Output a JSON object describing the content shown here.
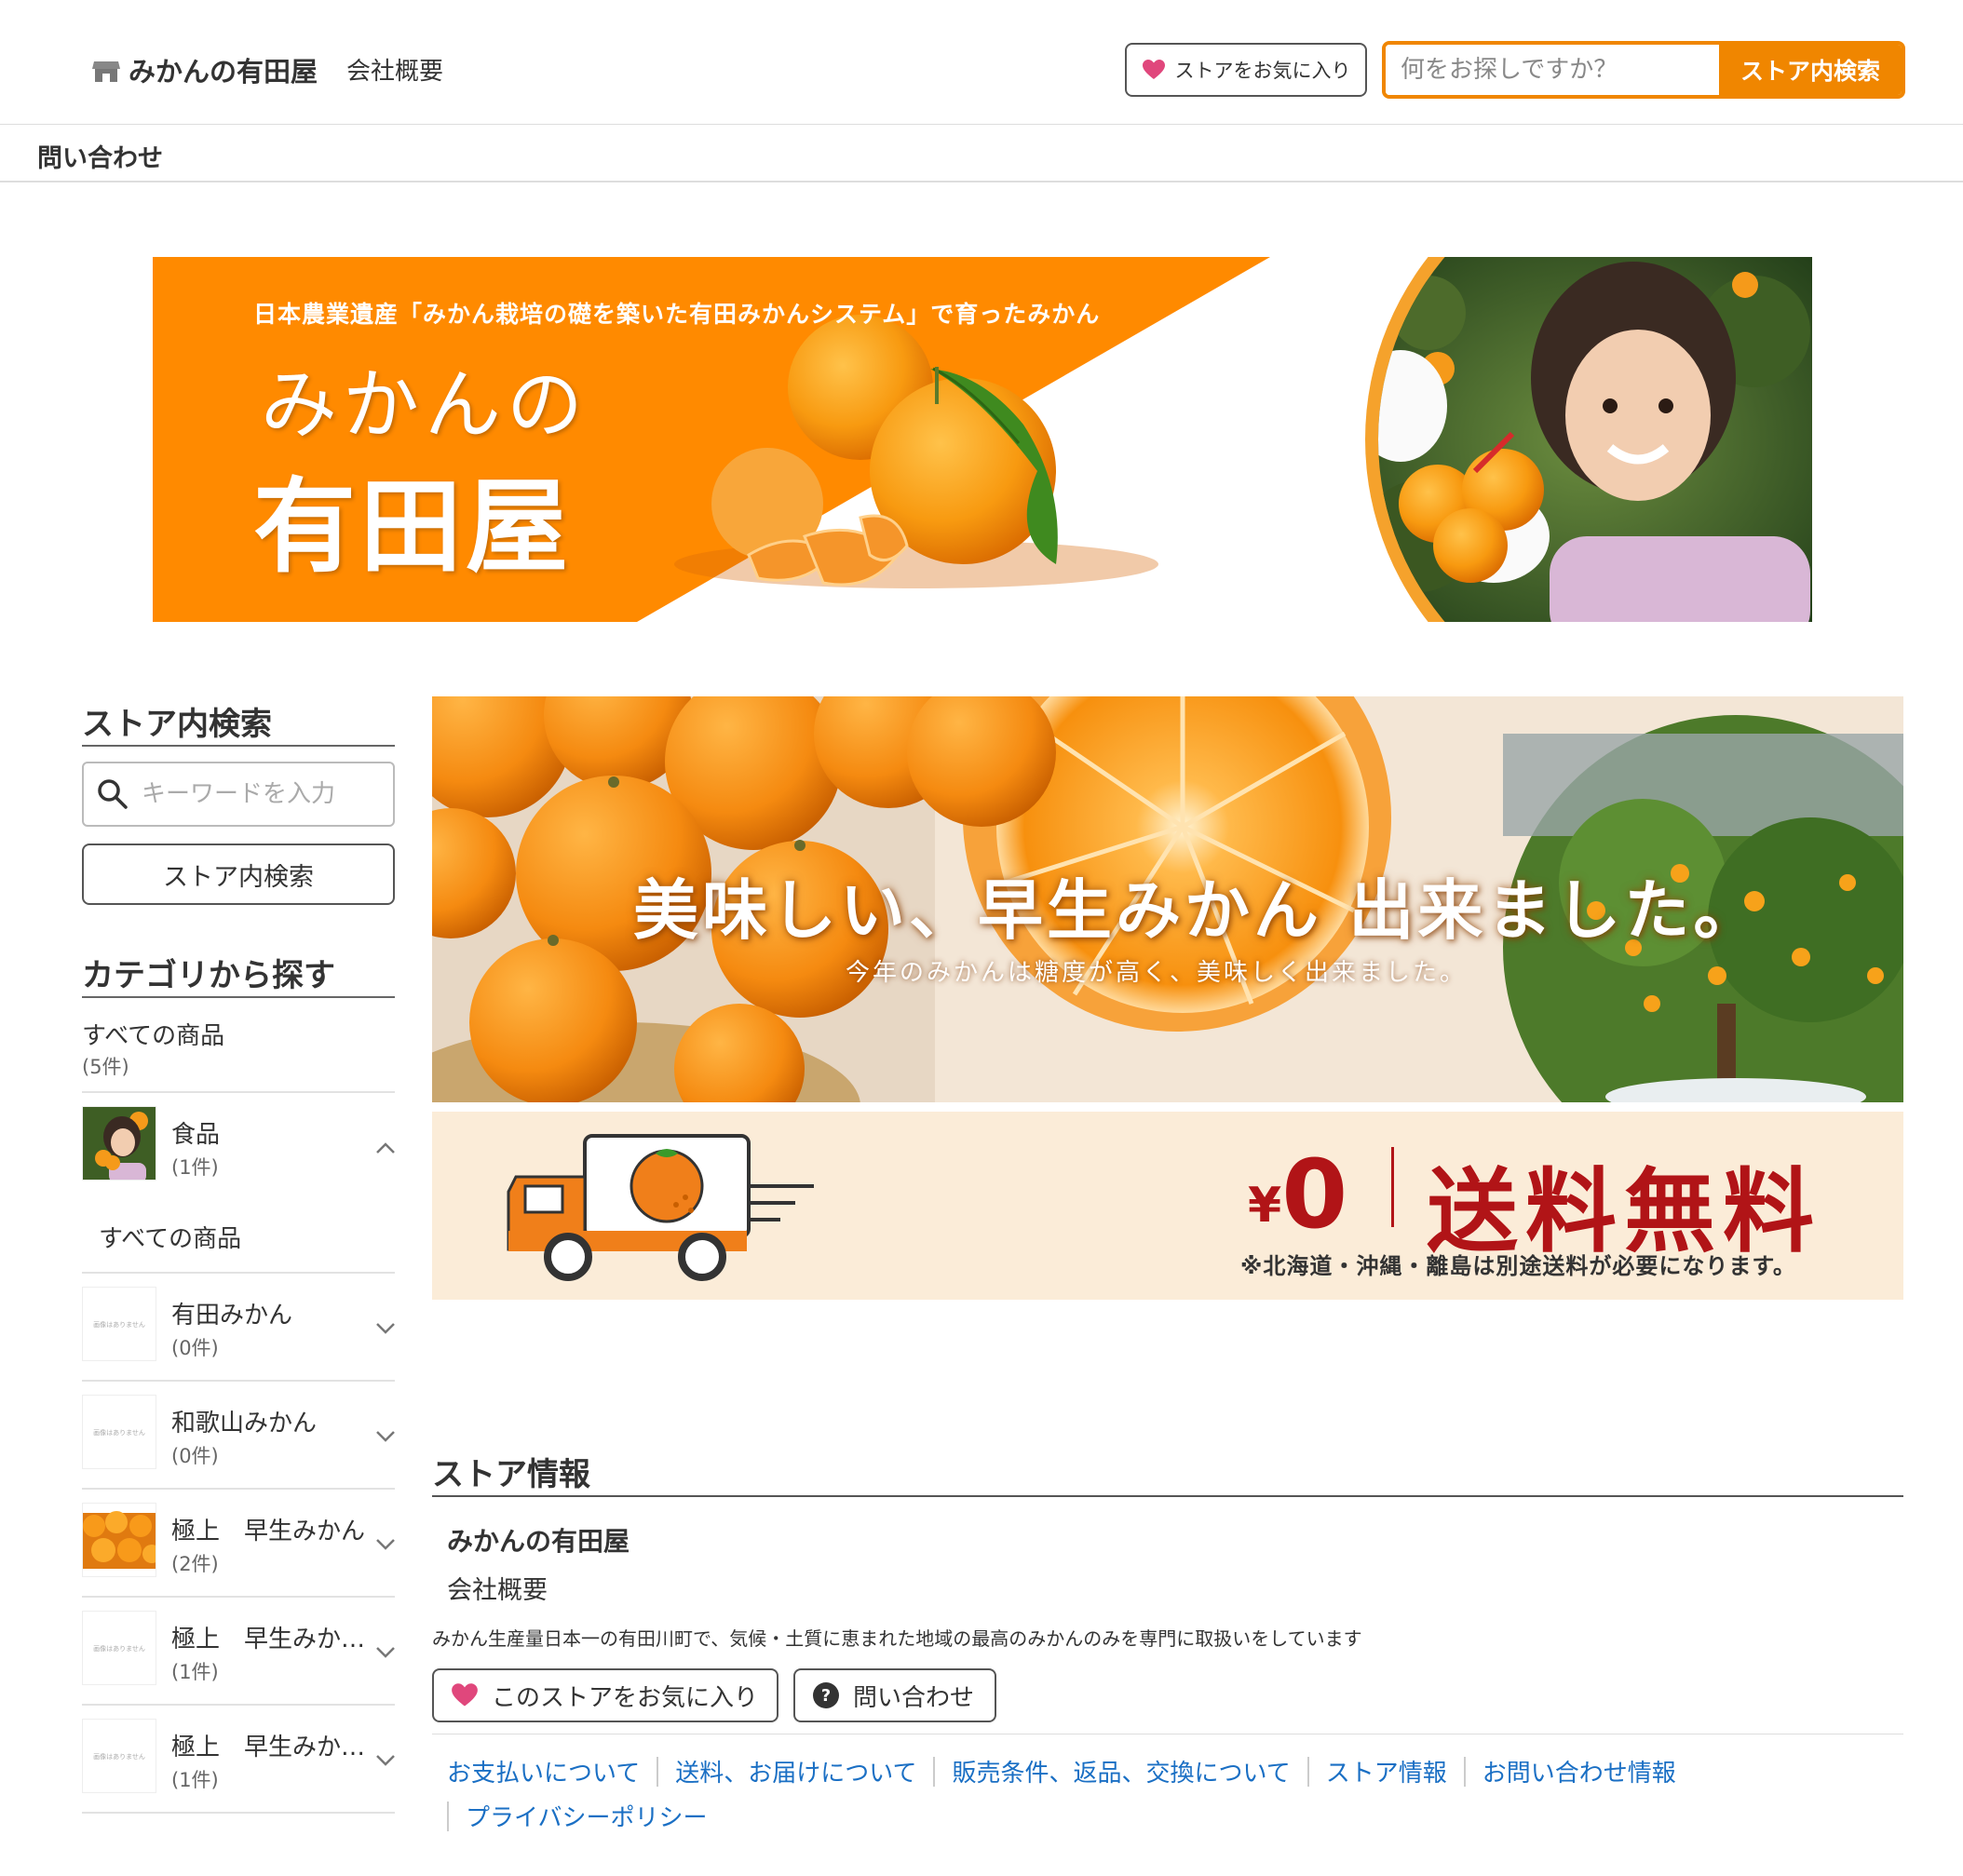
{
  "header": {
    "store_name": "みかんの有田屋",
    "company_link": "会社概要",
    "favorite_label": "ストアをお気に入り",
    "search_placeholder": "何をお探しですか？",
    "search_button": "ストア内検索",
    "contact_link": "問い合わせ"
  },
  "banner_main": {
    "subtitle": "日本農業遺産「みかん栽培の礎を築いた有田みかんシステム」で育ったみかん",
    "title_line1": "みかんの",
    "title_line2": "有田屋"
  },
  "sidebar": {
    "search_heading": "ストア内検索",
    "keyword_placeholder": "キーワードを入力",
    "search_button": "ストア内検索",
    "category_heading": "カテゴリから探す",
    "all_products": {
      "name": "すべての商品",
      "count": "(5件)"
    },
    "categories": [
      {
        "name": "食品",
        "count": "(1件)",
        "thumb": "photo-girl",
        "expanded": true
      },
      {
        "name": "有田みかん",
        "count": "(0件)",
        "thumb": "no-image"
      },
      {
        "name": "和歌山みかん",
        "count": "(0件)",
        "thumb": "no-image"
      },
      {
        "name": "極上　早生みかん",
        "count": "(2件)",
        "thumb": "photo-oranges"
      },
      {
        "name": "極上　早生みか…",
        "count": "(1件)",
        "thumb": "no-image"
      },
      {
        "name": "極上　早生みか…",
        "count": "(1件)",
        "thumb": "no-image"
      }
    ],
    "sub_all_products": "すべての商品",
    "no_image_text": "画像はありません"
  },
  "banner_wase": {
    "title": "美味しい、早生みかん 出来ました。",
    "subtitle": "今年のみかんは糖度が高く、美味しく出来ました。"
  },
  "banner_shipping": {
    "yen_mark": "¥",
    "price": "0",
    "title": "送料無料",
    "note": "※北海道・沖縄・離島は別途送料が必要になります。"
  },
  "store_info": {
    "heading": "ストア情報",
    "name": "みかんの有田屋",
    "company": "会社概要",
    "description": "みかん生産量日本一の有田川町で、気候・土質に恵まれた地域の最高のみかんのみを専門に取扱いをしています",
    "favorite_button": "このストアをお気に入り",
    "contact_button": "問い合わせ",
    "links": [
      "お支払いについて",
      "送料、お届けについて",
      "販売条件、返品、交換について",
      "ストア情報",
      "お問い合わせ情報",
      "プライバシーポリシー"
    ]
  },
  "colors": {
    "accent_orange": "#f08600",
    "banner_orange": "#ff8a00",
    "heart_pink": "#e0477c",
    "link_blue": "#1a6fc4",
    "shipping_red": "#b11417",
    "shipping_bg": "#fbecd8"
  }
}
